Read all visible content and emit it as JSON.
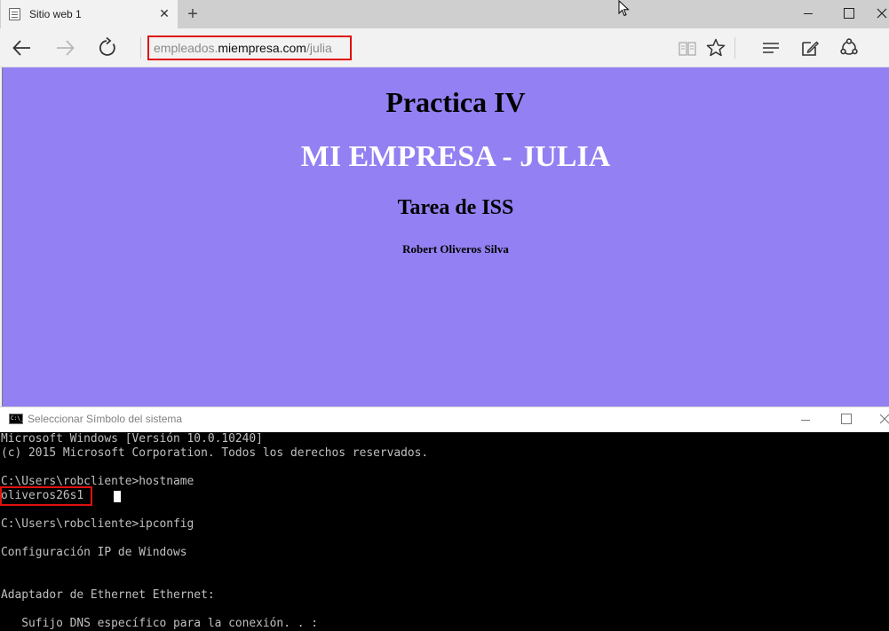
{
  "browser": {
    "tab": {
      "title": "Sitio web 1"
    },
    "address": {
      "prefix": "empleados.",
      "domain": "miempresa.com",
      "suffix": "/julia"
    }
  },
  "page": {
    "h1": "Practica IV",
    "h2": "MI EMPRESA - JULIA",
    "h3": "Tarea de ISS",
    "h4": "Robert Oliveros Silva",
    "background": "#9380f2",
    "h2_color": "#ffffff"
  },
  "cmd": {
    "title": "Seleccionar Símbolo del sistema",
    "lines": [
      "Microsoft Windows [Versión 10.0.10240]",
      "(c) 2015 Microsoft Corporation. Todos los derechos reservados.",
      "",
      "C:\\Users\\robcliente>hostname",
      "oliveros26s1",
      "",
      "C:\\Users\\robcliente>ipconfig",
      "",
      "Configuración IP de Windows",
      "",
      "",
      "Adaptador de Ethernet Ethernet:",
      "",
      "   Sufijo DNS específico para la conexión. . :"
    ]
  },
  "colors": {
    "highlight": "#e01010",
    "console_bg": "#000000",
    "console_fg": "#c0c0c0"
  }
}
